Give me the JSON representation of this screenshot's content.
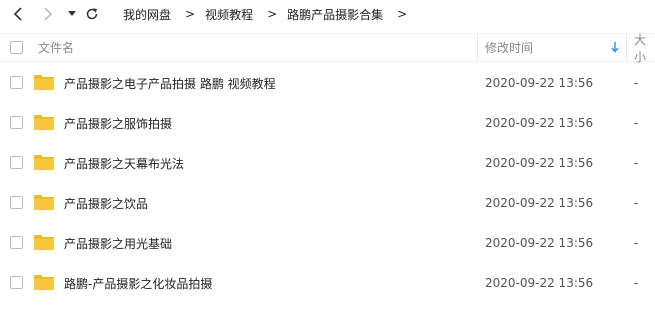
{
  "toolbar": {
    "back_icon": "chevron-left-icon",
    "forward_icon": "chevron-right-icon",
    "dropdown_icon": "caret-down-icon",
    "refresh_icon": "refresh-icon"
  },
  "breadcrumb": {
    "items": [
      "我的网盘",
      "视频教程",
      "路鹏产品摄影合集"
    ],
    "separator": ">"
  },
  "columns": {
    "name": "文件名",
    "modified": "修改时间",
    "size": "大小",
    "sort_icon": "arrow-down-icon",
    "sort_color": "#2b8ef0"
  },
  "colors": {
    "folder": "#f9c73c",
    "folder_back": "#f0b824"
  },
  "files": [
    {
      "name": "产品摄影之电子产品拍摄 路鹏 视频教程",
      "modified": "2020-09-22 13:56",
      "size": "-"
    },
    {
      "name": "产品摄影之服饰拍摄",
      "modified": "2020-09-22 13:56",
      "size": "-"
    },
    {
      "name": "产品摄影之天幕布光法",
      "modified": "2020-09-22 13:56",
      "size": "-"
    },
    {
      "name": "产品摄影之饮品",
      "modified": "2020-09-22 13:56",
      "size": "-"
    },
    {
      "name": "产品摄影之用光基础",
      "modified": "2020-09-22 13:56",
      "size": "-"
    },
    {
      "name": "路鹏-产品摄影之化妆品拍摄",
      "modified": "2020-09-22 13:56",
      "size": "-"
    }
  ]
}
